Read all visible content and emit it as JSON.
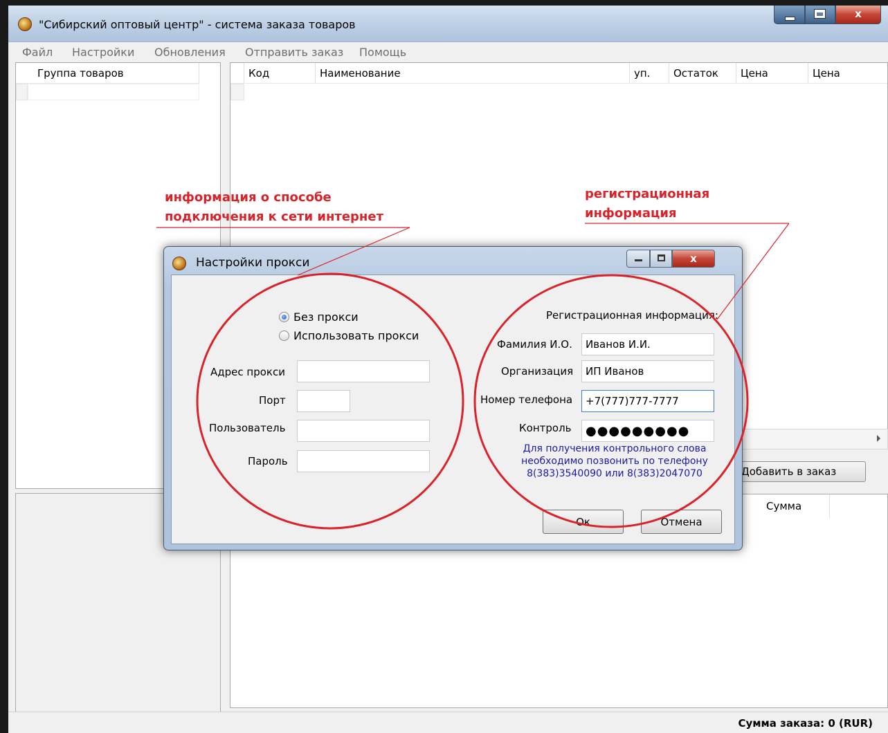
{
  "window": {
    "title": "\"Сибирский оптовый центр\" - система заказа товаров",
    "close_glyph": "x"
  },
  "menu": {
    "items": [
      "Файл",
      "Настройки",
      "Обновления",
      "Отправить заказ",
      "Помощь"
    ]
  },
  "group_panel": {
    "header": "Группа товаров"
  },
  "product_table": {
    "columns": [
      "Код",
      "Наименование",
      "уп.",
      "Остаток",
      "Цена",
      "Цена"
    ]
  },
  "buttons": {
    "add_to_order": "Добавить в заказ"
  },
  "order_table": {
    "columns": [
      "Сумма"
    ]
  },
  "status": {
    "order_total": "Сумма заказа: 0 (RUR)"
  },
  "annotations": {
    "connection": [
      "информация о способе",
      "подключения к сети интернет"
    ],
    "registration": [
      "регистрационная",
      "информация"
    ]
  },
  "dialog": {
    "title": "Настройки прокси",
    "close_glyph": "x",
    "proxy": {
      "no_proxy": "Без прокси",
      "use_proxy": "Использовать прокси",
      "selected": "no_proxy",
      "address_label": "Адрес прокси",
      "port_label": "Порт",
      "user_label": "Пользователь",
      "password_label": "Пароль",
      "address_value": "",
      "port_value": "",
      "user_value": "",
      "password_value": ""
    },
    "registration": {
      "heading": "Регистрационная информация:",
      "name_label": "Фамилия И.О.",
      "name_value": "Иванов И.И.",
      "org_label": "Организация",
      "org_value": "ИП Иванов",
      "phone_label": "Номер телефона",
      "phone_value": "+7(777)777-7777",
      "control_label": "Контроль",
      "control_value": "●●●●●●●●●",
      "hint": "Для получения контрольного слова необходимо позвонить по телефону 8(383)3540090 или 8(383)2047070"
    },
    "ok": "Ок",
    "cancel": "Отмена"
  },
  "colors": {
    "annotation_red": "#d9232a",
    "hint_blue": "#1a1aa6",
    "close_red": "#c64536"
  }
}
